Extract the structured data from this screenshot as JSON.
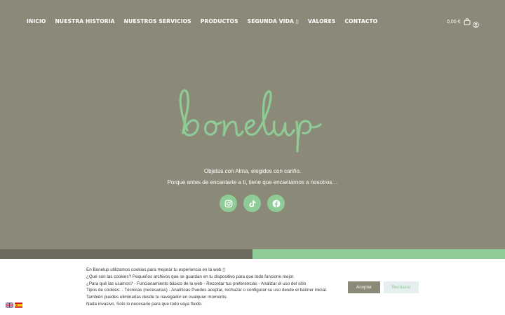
{
  "nav": {
    "items": [
      {
        "label": "INICIO"
      },
      {
        "label": "NUESTRA HISTORIA"
      },
      {
        "label": "NUESTROS SERVICIOS"
      },
      {
        "label": "PRODUCTOS"
      },
      {
        "label": "SEGUNDA VIDA ▯"
      },
      {
        "label": "VALORES"
      },
      {
        "label": "CONTACTO"
      }
    ]
  },
  "cart": {
    "amount": "0,00 €",
    "icon": "shopping-bag-icon"
  },
  "account": {
    "icon": "user-icon"
  },
  "hero": {
    "logo_text": "bonelup",
    "logo_color": "#8fcb97",
    "tagline1": "Objetos con Alma, elegidos con cariño.",
    "tagline2": "Porque antes de encantarte a ti, tiene que encantarnos a nosotros…"
  },
  "socials": [
    {
      "icon": "instagram-icon"
    },
    {
      "icon": "tiktok-icon"
    },
    {
      "icon": "facebook-icon"
    }
  ],
  "cookie": {
    "lines": [
      "En Bonelup utilizamos cookies para mejorar tu experiencia en la web ▯",
      "¿Qué son las cookies? Pequeños archivos que se guardan en tu dispositivo para que todo funcione mejor.",
      "¿Para qué las usamos? - Funcionamiento básico de la web - Recordar tus preferencias - Analizar el uso del sitio",
      "Tipos de cookies: - Técnicas (necesarias) - Analíticas Puedes aceptar, rechazar o configurar su uso desde el banner inicial.",
      "También puedes eliminarlas desde tu navegador en cualquier momento.",
      "Nada invasivo. Solo lo necesario para que todo vaya fluido."
    ],
    "accept_label": "Aceptar",
    "reject_label": "Rechazar"
  },
  "colors": {
    "background": "#8b8a78",
    "accent": "#8fcb97",
    "band_dark": "#6e6c5f"
  },
  "languages": [
    {
      "icon": "uk-flag-icon"
    },
    {
      "icon": "spain-flag-icon"
    }
  ]
}
